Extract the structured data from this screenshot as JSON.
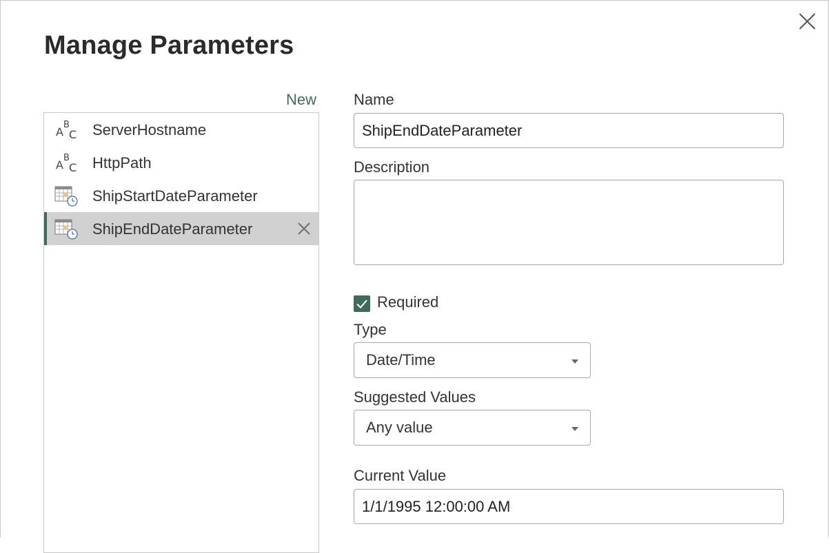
{
  "dialog": {
    "title": "Manage Parameters",
    "new_label": "New"
  },
  "parameters": [
    {
      "icon": "text-type-icon",
      "icon_letters": [
        "A",
        "B",
        "C"
      ],
      "label": "ServerHostname"
    },
    {
      "icon": "text-type-icon",
      "icon_letters": [
        "A",
        "B",
        "C"
      ],
      "label": "HttpPath"
    },
    {
      "icon": "datetime-type-icon",
      "label": "ShipStartDateParameter"
    },
    {
      "icon": "datetime-type-icon",
      "label": "ShipEndDateParameter",
      "selected": true
    }
  ],
  "form": {
    "name_label": "Name",
    "name_value": "ShipEndDateParameter",
    "description_label": "Description",
    "description_value": "",
    "required_label": "Required",
    "required_checked": true,
    "type_label": "Type",
    "type_value": "Date/Time",
    "suggested_label": "Suggested Values",
    "suggested_value": "Any value",
    "current_label": "Current Value",
    "current_value": "1/1/1995 12:00:00 AM"
  },
  "colors": {
    "accent": "#3e6b5b",
    "selected_row": "#d1d1d1",
    "border": "#a6a6a6"
  }
}
